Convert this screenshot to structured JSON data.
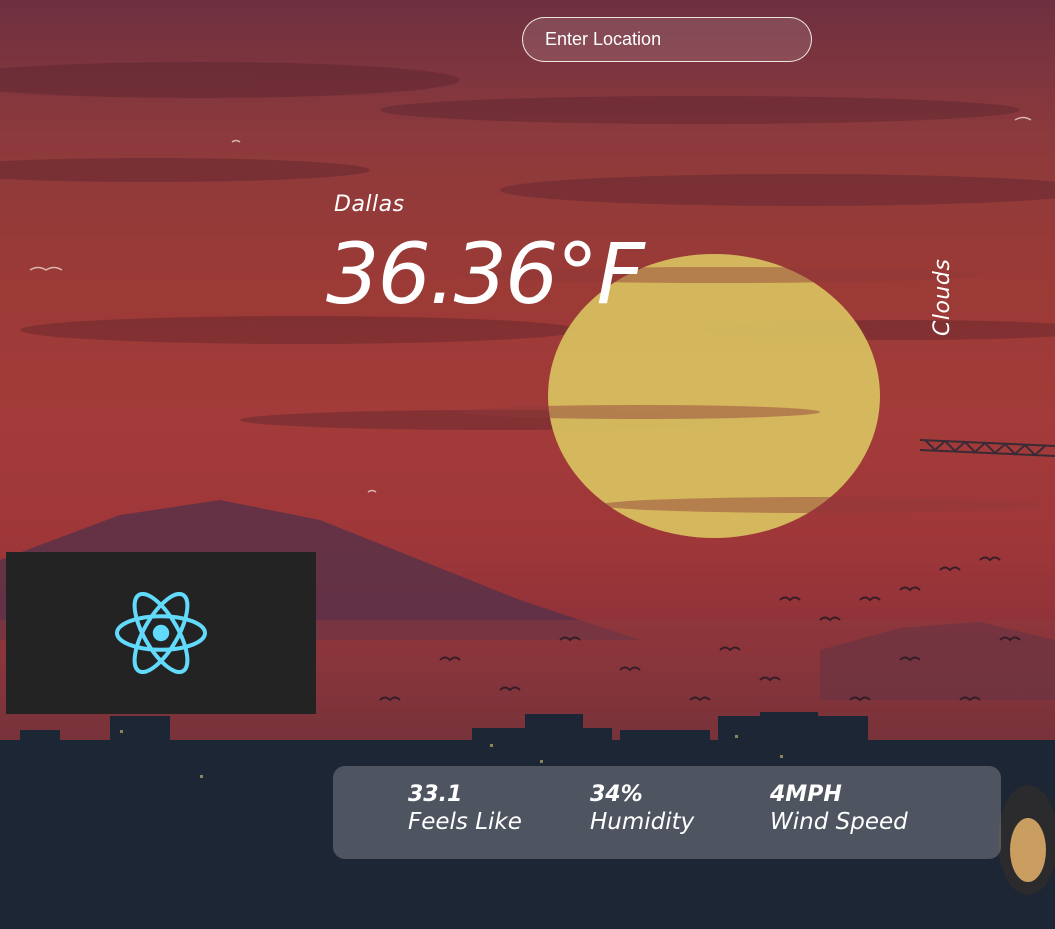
{
  "search": {
    "placeholder": "Enter Location",
    "value": ""
  },
  "location": {
    "city": "Dallas"
  },
  "weather": {
    "temperature": "36.36°F",
    "condition": "Clouds"
  },
  "stats": [
    {
      "value": "33.1",
      "label": "Feels Like"
    },
    {
      "value": "34%",
      "label": "Humidity"
    },
    {
      "value": "4MPH",
      "label": "Wind Speed"
    }
  ],
  "colors": {
    "sun": "#d9c261",
    "react_blue": "#61dafb",
    "logo_bg": "#232323"
  },
  "icons": {
    "logo": "react-logo-icon"
  }
}
